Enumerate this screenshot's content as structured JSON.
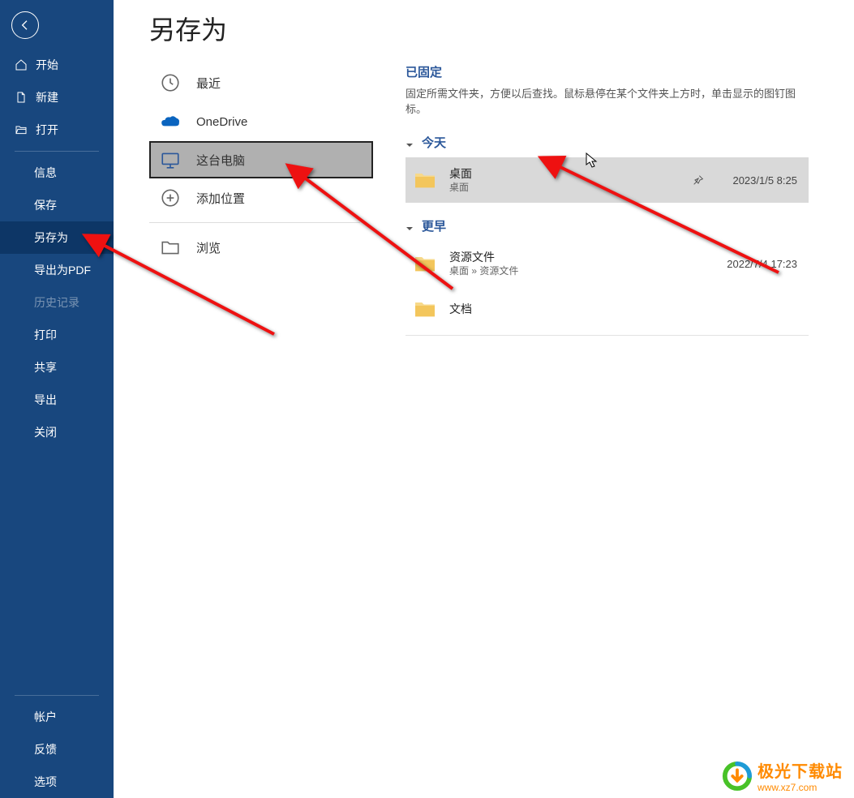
{
  "sidebar": {
    "top": [
      {
        "label": "开始",
        "icon": "home"
      },
      {
        "label": "新建",
        "icon": "file"
      },
      {
        "label": "打开",
        "icon": "open"
      }
    ],
    "middle": [
      {
        "label": "信息"
      },
      {
        "label": "保存"
      },
      {
        "label": "另存为",
        "active": true
      },
      {
        "label": "导出为PDF"
      },
      {
        "label": "历史记录",
        "disabled": true
      },
      {
        "label": "打印"
      },
      {
        "label": "共享"
      },
      {
        "label": "导出"
      },
      {
        "label": "关闭"
      }
    ],
    "bottom": [
      {
        "label": "帐户"
      },
      {
        "label": "反馈"
      },
      {
        "label": "选项"
      }
    ]
  },
  "pageTitle": "另存为",
  "locations": [
    {
      "label": "最近",
      "icon": "clock"
    },
    {
      "label": "OneDrive",
      "icon": "onedrive"
    },
    {
      "label": "这台电脑",
      "icon": "thispc",
      "selected": true
    },
    {
      "label": "添加位置",
      "icon": "addloc"
    },
    {
      "label": "浏览",
      "icon": "browse"
    }
  ],
  "pinned": {
    "title": "已固定",
    "desc": "固定所需文件夹，方便以后查找。鼠标悬停在某个文件夹上方时，单击显示的图钉图标。"
  },
  "groups": [
    {
      "title": "今天",
      "items": [
        {
          "name": "桌面",
          "path": "桌面",
          "date": "2023/1/5 8:25",
          "hovered": true,
          "pin": true
        }
      ]
    },
    {
      "title": "更早",
      "items": [
        {
          "name": "资源文件",
          "path": "桌面 » 资源文件",
          "date": "2022/7/4 17:23"
        },
        {
          "name": "文档",
          "path": ""
        }
      ]
    }
  ],
  "watermark": {
    "line1": "极光下载站",
    "line2": "www.xz7.com"
  }
}
